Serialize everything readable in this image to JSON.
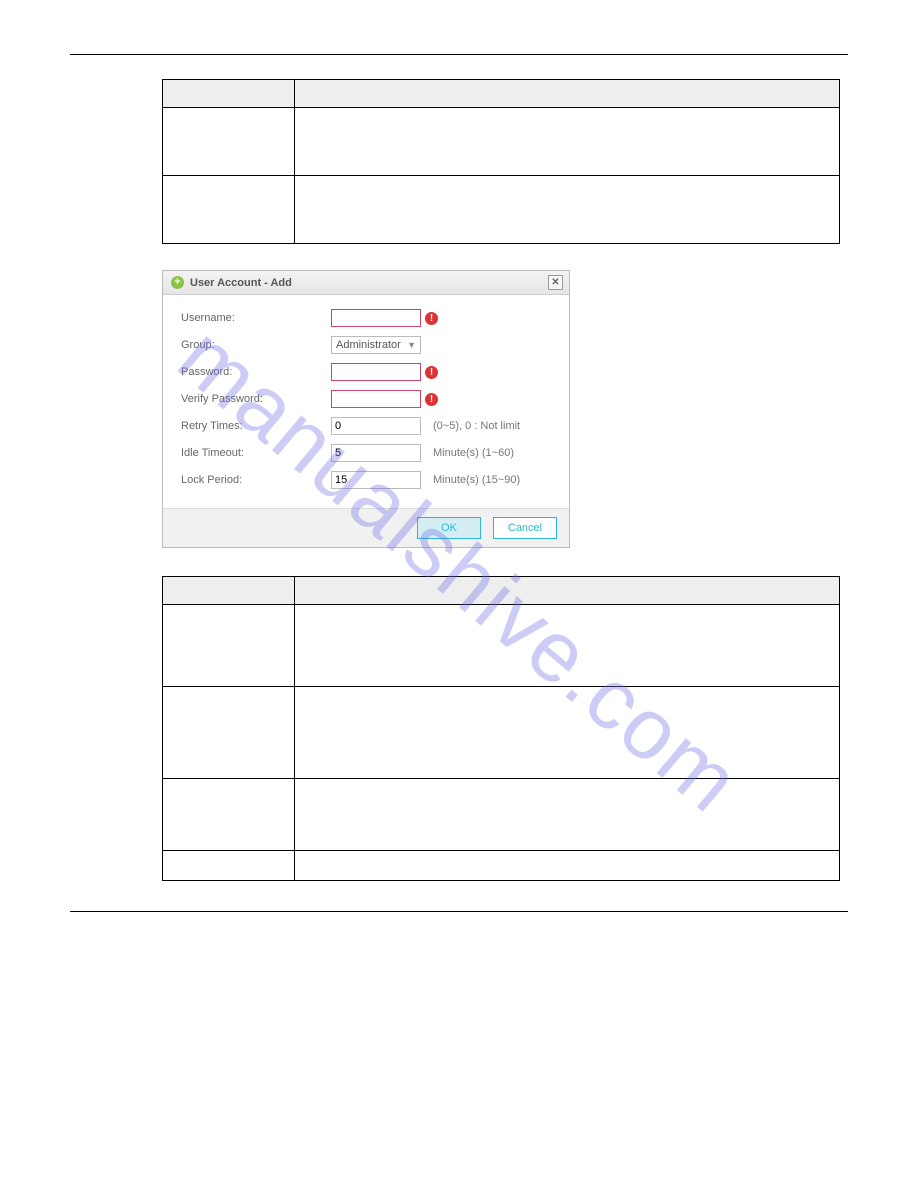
{
  "watermark": "manualshive.com",
  "table1": {
    "header_col1": "",
    "header_col2": "",
    "rows": [
      {
        "label": "",
        "desc": ""
      },
      {
        "label": "",
        "desc": ""
      }
    ]
  },
  "dialog": {
    "title": "User Account - Add",
    "icon_name": "plus-icon",
    "close_icon": "close-icon",
    "fields": {
      "username": {
        "label": "Username:",
        "value": ""
      },
      "group": {
        "label": "Group:",
        "selected": "Administrator"
      },
      "password": {
        "label": "Password:",
        "value": ""
      },
      "verify": {
        "label": "Verify Password:",
        "value": ""
      },
      "retry": {
        "label": "Retry Times:",
        "value": "0",
        "hint": "(0~5), 0 : Not limit"
      },
      "idle": {
        "label": "Idle Timeout:",
        "value": "5",
        "hint": "Minute(s) (1~60)"
      },
      "lock": {
        "label": "Lock Period:",
        "value": "15",
        "hint": "Minute(s) (15~90)"
      }
    },
    "buttons": {
      "ok": "OK",
      "cancel": "Cancel"
    }
  },
  "table2": {
    "header_col1": "",
    "header_col2": "",
    "rows": [
      {
        "label": "",
        "desc": ""
      },
      {
        "label": "",
        "desc": ""
      },
      {
        "label": "",
        "desc": ""
      },
      {
        "label": "",
        "desc": ""
      }
    ]
  }
}
